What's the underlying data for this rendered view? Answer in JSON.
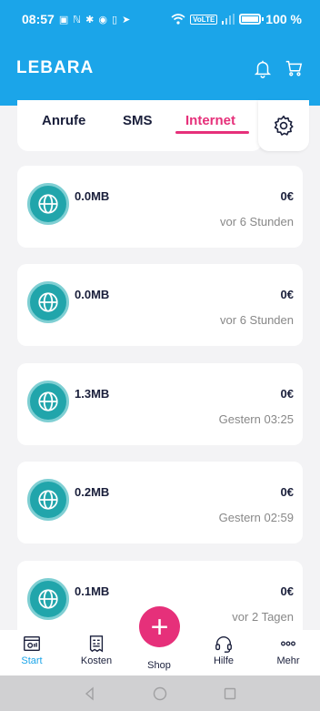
{
  "status_bar": {
    "time": "08:57",
    "left_icons": "▣ ℕ ✱ ◉ ▯ ➤",
    "volte": "VoLTE",
    "battery": "100 %"
  },
  "header": {
    "brand": "LEBARA",
    "icons": [
      "bell-icon",
      "cart-icon"
    ]
  },
  "tabs": {
    "calls": "Anrufe",
    "sms": "SMS",
    "internet": "Internet",
    "active": "Internet"
  },
  "usage_items": [
    {
      "amount": "0.0MB",
      "cost": "0€",
      "time": "vor 6 Stunden"
    },
    {
      "amount": "0.0MB",
      "cost": "0€",
      "time": "vor 6 Stunden"
    },
    {
      "amount": "1.3MB",
      "cost": "0€",
      "time": "Gestern 03:25"
    },
    {
      "amount": "0.2MB",
      "cost": "0€",
      "time": "Gestern 02:59"
    },
    {
      "amount": "0.1MB",
      "cost": "0€",
      "time": "vor 2 Tagen"
    }
  ],
  "bottom_nav": {
    "start": "Start",
    "kosten": "Kosten",
    "shop": "Shop",
    "hilfe": "Hilfe",
    "mehr": "Mehr",
    "fab": "+"
  },
  "colors": {
    "brand_blue": "#1ba5e9",
    "accent_pink": "#e6307a",
    "icon_teal": "#21a5ab"
  }
}
